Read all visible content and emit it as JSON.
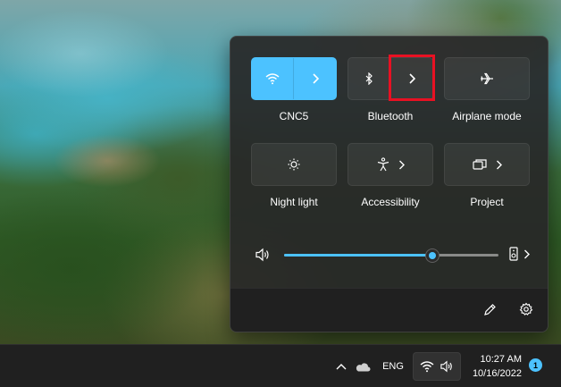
{
  "quick_settings": {
    "tiles": [
      {
        "label": "CNC5",
        "state": "on",
        "icon": "wifi-icon",
        "has_expand": true
      },
      {
        "label": "Bluetooth",
        "state": "off",
        "icon": "bluetooth-icon",
        "has_expand": true
      },
      {
        "label": "Airplane mode",
        "state": "off",
        "icon": "airplane-icon",
        "has_expand": false
      },
      {
        "label": "Night light",
        "state": "off",
        "icon": "brightness-icon",
        "has_expand": false
      },
      {
        "label": "Accessibility",
        "state": "off",
        "icon": "accessibility-icon",
        "has_expand": true
      },
      {
        "label": "Project",
        "state": "off",
        "icon": "project-icon",
        "has_expand": true
      }
    ],
    "volume": {
      "level_percent": 69,
      "icon": "speaker-icon",
      "output_icon": "audio-output-icon"
    },
    "footer": {
      "edit_icon": "pencil-icon",
      "settings_icon": "gear-icon"
    }
  },
  "taskbar": {
    "language": "ENG",
    "time": "10:27 AM",
    "date": "10/16/2022",
    "notification_count": "1"
  },
  "colors": {
    "accent": "#4cc2ff",
    "highlight_box": "#e81123",
    "flyout_bg": "#282828",
    "taskbar_bg": "#202020"
  }
}
